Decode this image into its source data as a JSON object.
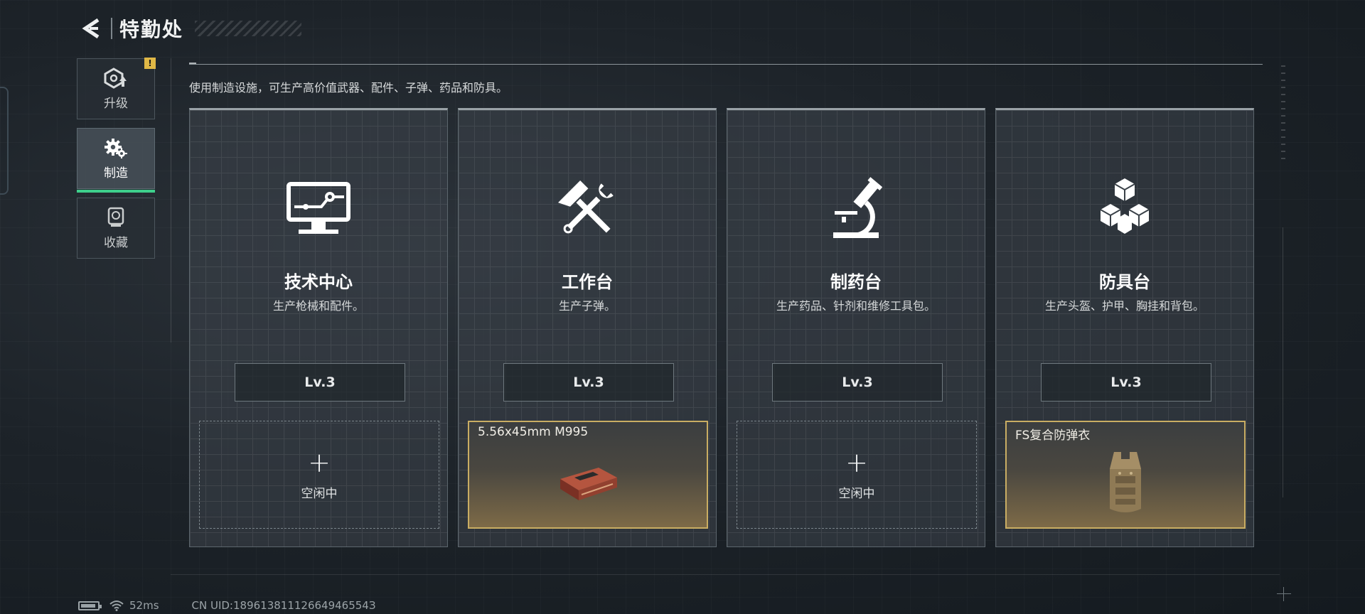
{
  "header": {
    "title": "特勤处"
  },
  "sidebar": {
    "items": [
      {
        "label": "升级",
        "icon": "upgrade-icon",
        "badge": "!"
      },
      {
        "label": "制造",
        "icon": "gear-manufacture-icon",
        "active": true
      },
      {
        "label": "收藏",
        "icon": "collection-icon"
      }
    ]
  },
  "description": "使用制造设施，可生产高价值武器、配件、子弹、药品和防具。",
  "cards": [
    {
      "name": "技术中心",
      "desc": "生产枪械和配件。",
      "level": "Lv.3",
      "icon": "monitor-circuit-icon",
      "slot": {
        "state": "idle",
        "plus": "+",
        "text": "空闲中"
      }
    },
    {
      "name": "工作台",
      "desc": "生产子弹。",
      "level": "Lv.3",
      "icon": "hammer-wrench-icon",
      "slot": {
        "state": "busy",
        "item": "5.56x45mm M995",
        "item_icon": "ammo-box-icon"
      }
    },
    {
      "name": "制药台",
      "desc": "生产药品、针剂和维修工具包。",
      "level": "Lv.3",
      "icon": "microscope-icon",
      "slot": {
        "state": "idle",
        "plus": "+",
        "text": "空闲中"
      }
    },
    {
      "name": "防具台",
      "desc": "生产头盔、护甲、胸挂和背包。",
      "level": "Lv.3",
      "icon": "cubes-icon",
      "slot": {
        "state": "busy",
        "item": "FS复合防弹衣",
        "item_icon": "body-armor-icon"
      }
    }
  ],
  "status": {
    "ping": "52ms",
    "uid": "CN UID:18961381112664946554З"
  },
  "colors": {
    "accent_green": "#3ecf8c",
    "gold_border": "#c9ad63",
    "warning_badge": "#e0b846"
  }
}
